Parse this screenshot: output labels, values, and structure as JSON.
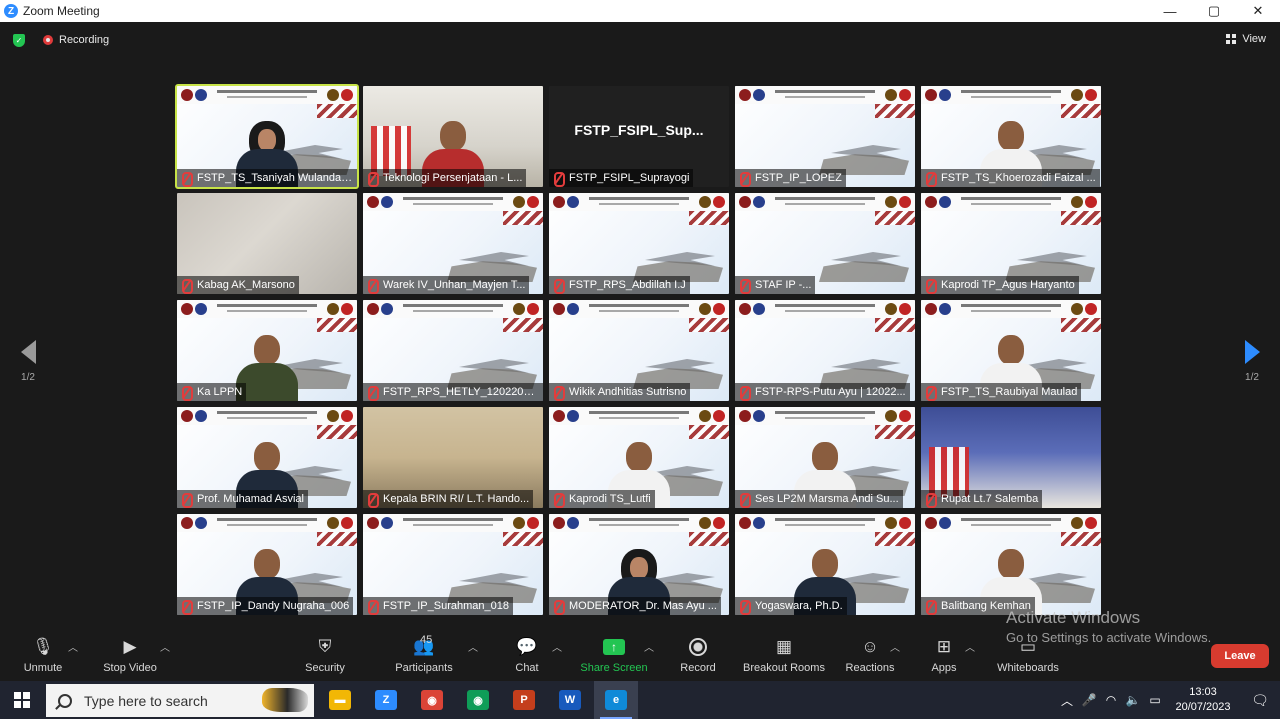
{
  "window": {
    "title": "Zoom Meeting",
    "app_icon": "Z",
    "minimize": "—",
    "maximize": "▢",
    "close": "✕"
  },
  "status": {
    "recording_label": "Recording",
    "view_label": "View"
  },
  "gallery": {
    "page_indicator_left": "1/2",
    "page_indicator_right": "1/2",
    "tiles": [
      {
        "name": "FSTP_TS_Tsaniyah Wulandari ...",
        "scene": "slide",
        "person": "hijab",
        "active": true
      },
      {
        "name": "Teknologi Persenjataan - L...",
        "scene": "room",
        "person": "red",
        "active": false
      },
      {
        "name": "FSTP_FSIPL_Suprayogi",
        "scene": "dark",
        "slide_text": "FSTP_FSIPL_Sup...",
        "person": "none",
        "active": false
      },
      {
        "name": "FSTP_IP_LOPEZ",
        "scene": "slide",
        "person": "none",
        "active": false
      },
      {
        "name": "FSTP_TS_Khoerozadi Faizal ...",
        "scene": "slide",
        "person": "white",
        "active": false
      },
      {
        "name": "Kabag AK_Marsono",
        "scene": "blurred",
        "person": "none",
        "active": false
      },
      {
        "name": "Warek IV_Unhan_Mayjen T...",
        "scene": "slide",
        "person": "none",
        "active": false
      },
      {
        "name": "FSTP_RPS_Abdillah I.J",
        "scene": "slide",
        "person": "none",
        "active": false
      },
      {
        "name": "STAF IP -...",
        "scene": "slide",
        "person": "none",
        "active": false
      },
      {
        "name": "Kaprodi TP_Agus Haryanto",
        "scene": "slide",
        "person": "none",
        "active": false
      },
      {
        "name": "Ka LPPN",
        "scene": "slide",
        "person": "green",
        "active": false
      },
      {
        "name": "FSTP_RPS_HETLY_12022040...",
        "scene": "slide",
        "person": "none",
        "active": false
      },
      {
        "name": "Wikik Andhitias Sutrisno",
        "scene": "slide",
        "person": "none",
        "active": false
      },
      {
        "name": "FSTP-RPS-Putu Ayu | 12022...",
        "scene": "slide",
        "person": "none",
        "active": false
      },
      {
        "name": "FSTP_TS_Raubiyal Maulad",
        "scene": "slide",
        "person": "white",
        "active": false
      },
      {
        "name": "Prof. Muhamad Asvial",
        "scene": "slide",
        "person": "suit",
        "active": false
      },
      {
        "name": "Kepala BRIN RI/ L.T. Hando...",
        "scene": "room2",
        "person": "none",
        "active": false
      },
      {
        "name": "Kaprodi TS_Lutfi",
        "scene": "slide",
        "person": "white",
        "active": false
      },
      {
        "name": "Ses LP2M Marsma Andi Su...",
        "scene": "slide",
        "person": "white",
        "active": false
      },
      {
        "name": "Rupat Lt.7 Salemba",
        "scene": "hall",
        "person": "none",
        "active": false
      },
      {
        "name": "FSTP_IP_Dandy Nugraha_006",
        "scene": "slide",
        "person": "suit",
        "active": false
      },
      {
        "name": "FSTP_IP_Surahman_018",
        "scene": "slide",
        "person": "none",
        "active": false
      },
      {
        "name": "MODERATOR_Dr. Mas Ayu ...",
        "scene": "slide",
        "person": "hijab",
        "active": false
      },
      {
        "name": "Yogaswara, Ph.D.",
        "scene": "slide",
        "person": "suit",
        "active": false
      },
      {
        "name": "Balitbang Kemhan",
        "scene": "slide",
        "person": "white",
        "active": false
      }
    ]
  },
  "toolbar": {
    "unmute": "Unmute",
    "stop_video": "Stop Video",
    "security": "Security",
    "participants": "Participants",
    "participants_count": "45",
    "chat": "Chat",
    "share_screen": "Share Screen",
    "record": "Record",
    "breakout_rooms": "Breakout Rooms",
    "reactions": "Reactions",
    "apps": "Apps",
    "whiteboards": "Whiteboards",
    "leave": "Leave"
  },
  "watermark": {
    "line1": "Activate Windows",
    "line2": "Go to Settings to activate Windows."
  },
  "taskbar": {
    "search_placeholder": "Type here to search",
    "time": "13:03",
    "date": "20/07/2023",
    "apps": [
      {
        "name": "file-explorer",
        "glyph": "▬",
        "color": "#f2b705"
      },
      {
        "name": "zoom",
        "glyph": "Z",
        "color": "#2d8cff"
      },
      {
        "name": "chrome",
        "glyph": "◉",
        "color": "#db4437"
      },
      {
        "name": "chrome-profile",
        "glyph": "◉",
        "color": "#0f9d58"
      },
      {
        "name": "powerpoint",
        "glyph": "P",
        "color": "#c43e1c"
      },
      {
        "name": "word",
        "glyph": "W",
        "color": "#185abd"
      },
      {
        "name": "edge",
        "glyph": "e",
        "color": "#0f8ad8"
      }
    ]
  }
}
